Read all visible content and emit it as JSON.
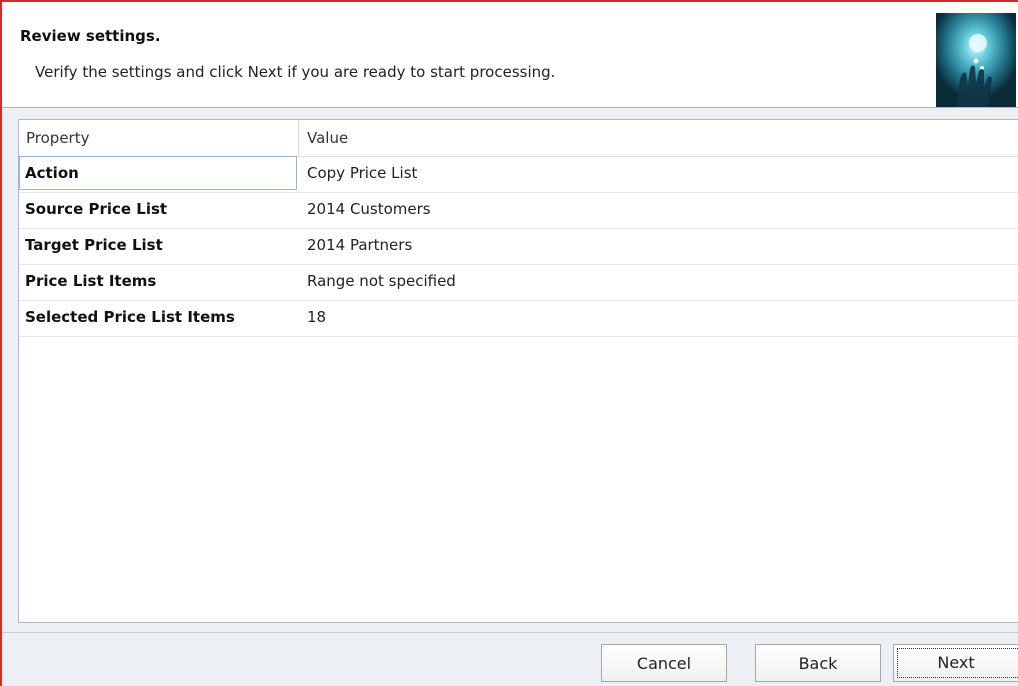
{
  "header": {
    "title": "Review settings.",
    "subtitle": "Verify the settings and click Next if you are ready to start processing.",
    "image_icon": "hand-touching-light-icon"
  },
  "grid": {
    "columns": [
      "Property",
      "Value"
    ],
    "rows": [
      {
        "property": "Action",
        "value": "Copy Price List",
        "selected": true
      },
      {
        "property": "Source Price List",
        "value": "2014 Customers"
      },
      {
        "property": "Target Price List",
        "value": "2014 Partners"
      },
      {
        "property": "Price List Items",
        "value": "Range not specified"
      },
      {
        "property": "Selected Price List Items",
        "value": "18"
      }
    ]
  },
  "buttons": {
    "cancel": "Cancel",
    "back": "Back",
    "next": "Next"
  },
  "colors": {
    "frame_accent": "#d42a2a",
    "band_background": "#ecf0f5",
    "grid_border": "#aab8c7"
  }
}
